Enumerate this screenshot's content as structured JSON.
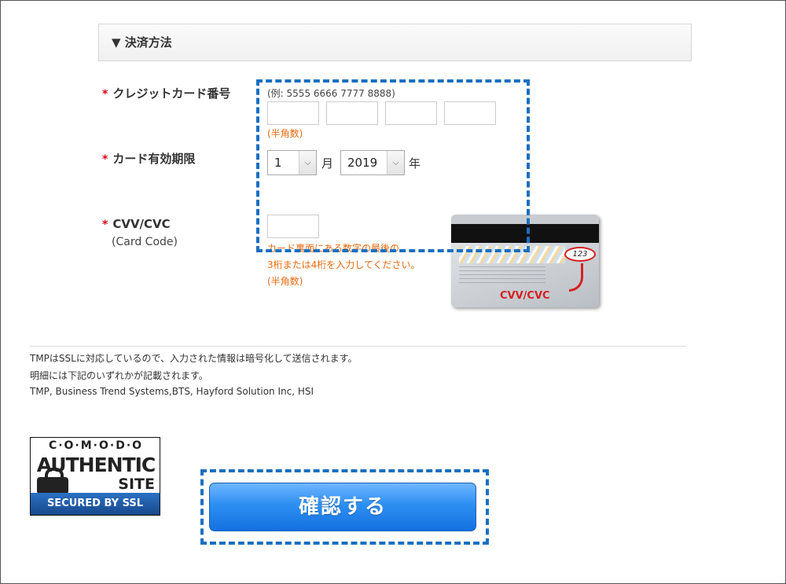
{
  "section": {
    "title": "▼ 決済方法"
  },
  "card_number": {
    "required_mark": "*",
    "label": "クレジットカード番号",
    "example": "(例: 5555 6666 7777 8888)",
    "segments": [
      "",
      "",
      "",
      ""
    ],
    "note": "(半角数)"
  },
  "expiry": {
    "required_mark": "*",
    "label": "カード有効期限",
    "month_value": "1",
    "month_unit": "月",
    "year_value": "2019",
    "year_unit": "年"
  },
  "cvv": {
    "required_mark": "*",
    "label": "CVV/CVC",
    "sublabel": "(Card Code)",
    "value": "",
    "note_line1": "カード裏面にある数字の最後の",
    "note_line2": "3桁または4桁を入力してください。",
    "note_line3": "(半角数)",
    "card_image": {
      "code_sample": "123",
      "caption": "CVV/CVC",
      "caption_color": "#d62020"
    }
  },
  "info": {
    "line1": "TMPはSSLに対応しているので、入力された情報は暗号化して送信されます。",
    "line2": "明細には下記のいずれかが記載されます。",
    "line3": "TMP, Business Trend Systems,BTS, Hayford Solution Inc, HSI"
  },
  "badge": {
    "line1": "C·O·M·O·D·O",
    "line2": "AUTHENTIC",
    "line3": "SITE",
    "line4": "SECURED BY SSL"
  },
  "confirm_button": {
    "label": "確認する"
  },
  "colors": {
    "accent": "#1a6fc0",
    "required": "#e60012",
    "note": "#e86a10",
    "button": "#2d8ff1"
  },
  "icons": {
    "dropdown": "chevron-down-icon",
    "lock": "padlock-icon"
  }
}
